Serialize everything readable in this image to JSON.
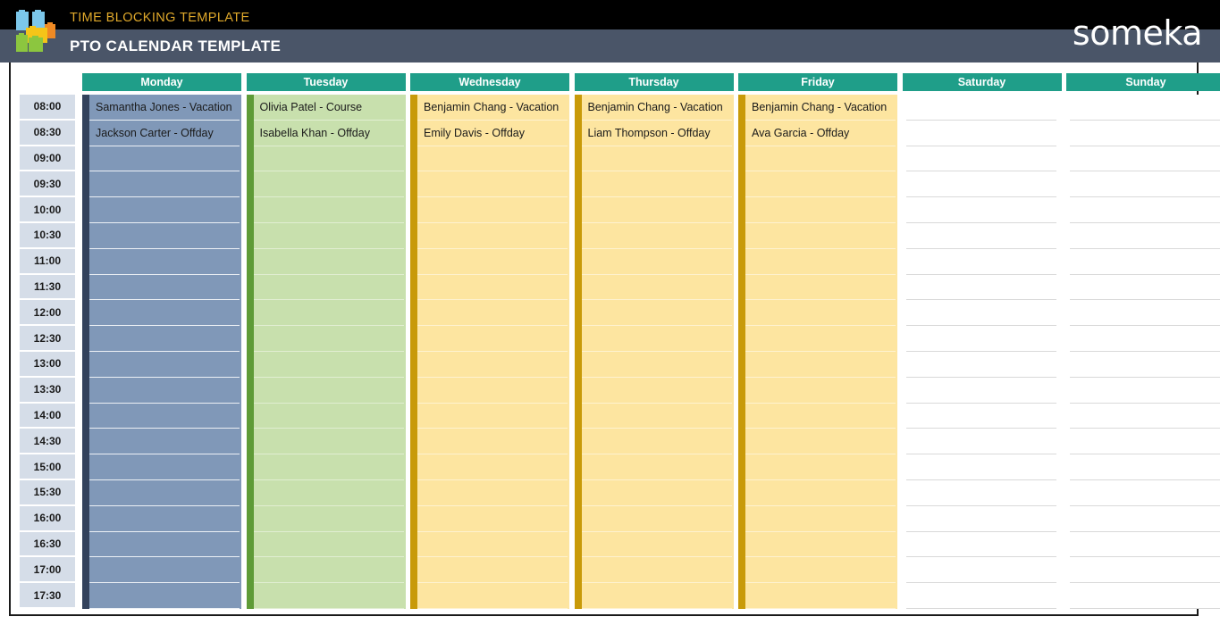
{
  "banner": {
    "subtitle": "TIME BLOCKING TEMPLATE",
    "title": "PTO CALENDAR TEMPLATE",
    "brand": "someka",
    "brand_letters_before": "s",
    "brand_letters_after": "meka",
    "logo_icon": "someka-blocks-logo",
    "colors": {
      "top_band": "#000000",
      "title_band": "#4a5568",
      "subtitle_text": "#e0a92b",
      "title_text": "#ffffff"
    }
  },
  "calendar": {
    "header_accent_color": "#1f9e89",
    "time_column_color": "#d5dde8",
    "times": [
      "08:00",
      "08:30",
      "09:00",
      "09:30",
      "10:00",
      "10:30",
      "11:00",
      "11:30",
      "12:00",
      "12:30",
      "13:00",
      "13:30",
      "14:00",
      "14:30",
      "15:00",
      "15:30",
      "16:00",
      "16:30",
      "17:00",
      "17:30"
    ],
    "days": [
      {
        "label": "Monday",
        "theme": "theme-mon",
        "accent_color": "#33425c",
        "fill_color": "#8098b8",
        "entries": [
          "Samantha Jones - Vacation",
          "Jackson Carter - Offday",
          "",
          "",
          "",
          "",
          "",
          "",
          "",
          "",
          "",
          "",
          "",
          "",
          "",
          "",
          "",
          "",
          "",
          ""
        ]
      },
      {
        "label": "Tuesday",
        "theme": "theme-tue",
        "accent_color": "#5e9b37",
        "fill_color": "#c8e0ad",
        "entries": [
          "Olivia Patel - Course",
          "Isabella Khan - Offday",
          "",
          "",
          "",
          "",
          "",
          "",
          "",
          "",
          "",
          "",
          "",
          "",
          "",
          "",
          "",
          "",
          "",
          ""
        ]
      },
      {
        "label": "Wednesday",
        "theme": "theme-amber",
        "accent_color": "#c89a09",
        "fill_color": "#fde5a0",
        "entries": [
          "Benjamin Chang - Vacation",
          "Emily Davis - Offday",
          "",
          "",
          "",
          "",
          "",
          "",
          "",
          "",
          "",
          "",
          "",
          "",
          "",
          "",
          "",
          "",
          "",
          ""
        ]
      },
      {
        "label": "Thursday",
        "theme": "theme-amber",
        "accent_color": "#c89a09",
        "fill_color": "#fde5a0",
        "entries": [
          "Benjamin Chang - Vacation",
          "Liam Thompson - Offday",
          "",
          "",
          "",
          "",
          "",
          "",
          "",
          "",
          "",
          "",
          "",
          "",
          "",
          "",
          "",
          "",
          "",
          ""
        ]
      },
      {
        "label": "Friday",
        "theme": "theme-amber",
        "accent_color": "#c89a09",
        "fill_color": "#fde5a0",
        "entries": [
          "Benjamin Chang - Vacation",
          "Ava Garcia - Offday",
          "",
          "",
          "",
          "",
          "",
          "",
          "",
          "",
          "",
          "",
          "",
          "",
          "",
          "",
          "",
          "",
          "",
          ""
        ]
      },
      {
        "label": "Saturday",
        "theme": "theme-blank",
        "accent_color": "",
        "fill_color": "#ffffff",
        "entries": [
          "",
          "",
          "",
          "",
          "",
          "",
          "",
          "",
          "",
          "",
          "",
          "",
          "",
          "",
          "",
          "",
          "",
          "",
          "",
          ""
        ]
      },
      {
        "label": "Sunday",
        "theme": "theme-blank",
        "accent_color": "",
        "fill_color": "#ffffff",
        "entries": [
          "",
          "",
          "",
          "",
          "",
          "",
          "",
          "",
          "",
          "",
          "",
          "",
          "",
          "",
          "",
          "",
          "",
          "",
          "",
          ""
        ]
      }
    ]
  }
}
